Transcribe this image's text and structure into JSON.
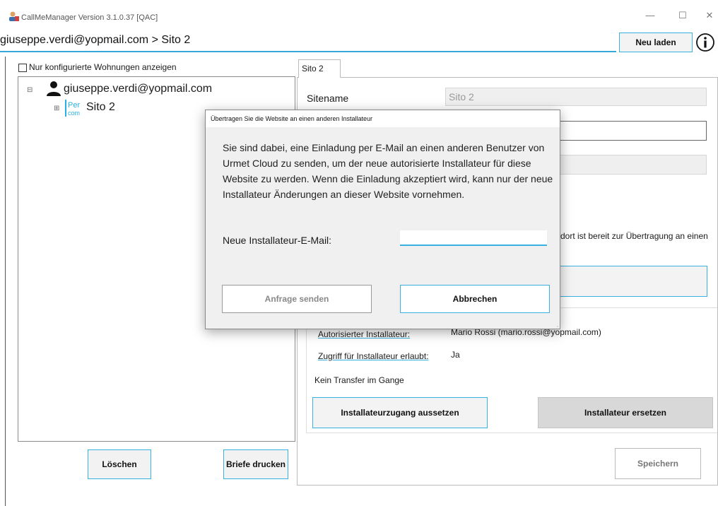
{
  "window": {
    "title": "CallMeManager Version 3.1.0.37 [QAC]",
    "minimize_glyph": "—",
    "maximize_glyph": "☐",
    "close_glyph": "✕"
  },
  "header": {
    "breadcrumb": "giuseppe.verdi@yopmail.com > Sito 2",
    "reload_label": "Neu laden",
    "info_icon": "info-icon",
    "accent_color": "#35a8d8"
  },
  "left_panel": {
    "checkbox_label": "Nur konfigurierte Wohnungen anzeigen",
    "checkbox_checked": false,
    "tree": {
      "root_expander": "⊟",
      "root_label": "giuseppe.verdi@yopmail.com",
      "root_icon": "user-icon",
      "child_expander": "⊞",
      "child_label": "Sito 2",
      "child_icon": "ipercom-logo"
    },
    "delete_label": "Löschen",
    "print_label": "Briefe drucken"
  },
  "right_panel": {
    "tab_label": "Sito 2",
    "sitename_label": "Sitename",
    "sitename_value": "Sito 2",
    "transfer_text": "dort ist bereit zur Übertragung an einen",
    "authorized_installer_label": "Autorisierter Installateur:",
    "authorized_installer_value": "Mario Rossi (mario.rossi@yopmail.com)",
    "access_allowed_label": "Zugriff für Installateur erlaubt:",
    "access_allowed_value": "Ja",
    "no_transfer_text": "Kein Transfer im Gange",
    "suspend_label": "Installateurzugang aussetzen",
    "replace_label": "Installateur ersetzen",
    "save_label": "Speichern"
  },
  "modal": {
    "title": "Übertragen Sie die Website an einen anderen Installateur",
    "message": "Sie sind dabei, eine Einladung per E-Mail an einen anderen Benutzer von Urmet Cloud zu senden, um der neue autorisierte Installateur für diese Website zu werden. Wenn die Einladung akzeptiert wird, kann nur der neue Installateur Änderungen an dieser Website vornehmen.",
    "email_label": "Neue Installateur-E-Mail:",
    "email_value": "",
    "send_label": "Anfrage senden",
    "cancel_label": "Abbrechen"
  }
}
